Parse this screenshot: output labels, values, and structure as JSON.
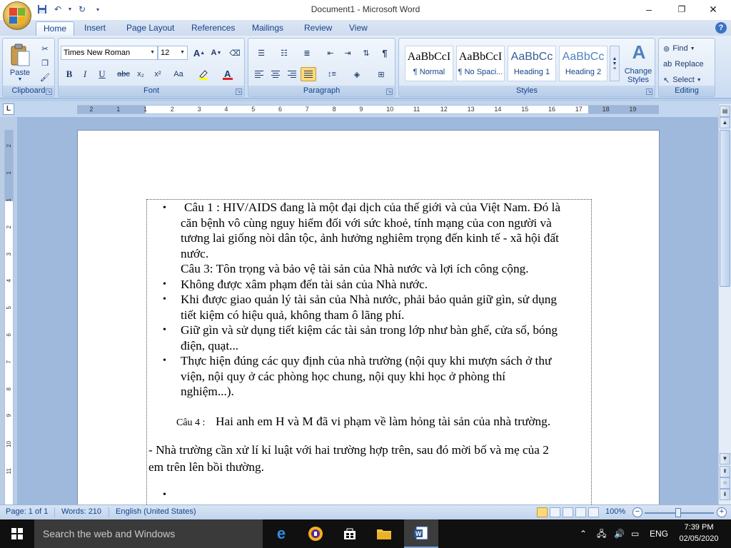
{
  "window": {
    "title": "Document1 - Microsoft Word",
    "minimize": "–",
    "maximize": "❐",
    "close": "✕"
  },
  "tabs": [
    "Home",
    "Insert",
    "Page Layout",
    "References",
    "Mailings",
    "Review",
    "View"
  ],
  "ribbon": {
    "clipboard": {
      "paste": "Paste",
      "label": "Clipboard"
    },
    "font": {
      "family": "Times New Roman",
      "size": "12",
      "label": "Font",
      "bold": "B",
      "italic": "I",
      "underline": "U",
      "strike": "abc",
      "subscript": "x₂",
      "superscript": "x²",
      "change_case": "Aa"
    },
    "paragraph": {
      "label": "Paragraph",
      "pilcrow": "¶"
    },
    "styles": {
      "label": "Styles",
      "items": [
        {
          "sample": "AaBbCcI",
          "name": "¶ Normal"
        },
        {
          "sample": "AaBbCcI",
          "name": "¶ No Spaci..."
        },
        {
          "sample": "AaBbCc",
          "name": "Heading 1"
        },
        {
          "sample": "AaBbCc",
          "name": "Heading 2"
        }
      ],
      "change_styles": "Change Styles"
    },
    "editing": {
      "label": "Editing",
      "find": "Find",
      "replace": "Replace",
      "select": "Select"
    }
  },
  "ruler": {
    "h_numbers": [
      "2",
      "1",
      "1",
      "2",
      "3",
      "4",
      "5",
      "6",
      "7",
      "8",
      "9",
      "10",
      "11",
      "12",
      "13",
      "14",
      "15",
      "16",
      "17",
      "18",
      "19"
    ],
    "v_numbers": [
      "2",
      "1",
      "1",
      "2",
      "3",
      "4",
      "5",
      "6",
      "7",
      "8",
      "9",
      "10",
      "11"
    ]
  },
  "document": {
    "lines": [
      "Câu 1  : HIV/AIDS đang là một đại dịch của thế giới và của Việt Nam. Đó là",
      "căn bệnh vô cùng nguy hiểm đối với sức khoẻ, tính mạng của con người và",
      "tương lai giống nòi dân tộc, ảnh hưởng nghiêm trọng đến kinh tế - xã hội đất",
      "nước.",
      "Câu 3: Tôn trọng và bảo vệ tài sản của Nhà nước và lợi ích công cộng.",
      "Không được xâm phạm đến tài sản của Nhà nước.",
      "Khi được giao quản lý tài sản của Nhà nước, phải bảo quản giữ gìn, sử dụng",
      "tiết kiệm có hiệu quả, không tham ô lãng phí.",
      "Giữ gìn và sử dụng tiết kiệm các tài sản trong lớp như bàn ghế, cửa sổ, bóng",
      "điện, quạt...",
      "Thực hiện đúng các quy định của nhà trường (nội quy khi mượn sách ở thư",
      "viện, nội quy ở các phòng học chung, nội quy khi học ở phòng thí",
      "nghiệm...).",
      "Câu 4 :",
      "Hai anh em H và M đã vi phạm về làm hỏng tài sản của nhà trường.",
      "- Nhà trường cần xử lí kỉ luật với hai trường hợp trên, sau đó mời bố và mẹ của 2",
      "em trên lên bồi thường."
    ],
    "bullet": "•"
  },
  "status": {
    "page": "Page: 1 of 1",
    "words": "Words: 210",
    "language": "English (United States)",
    "zoom": "100%"
  },
  "taskbar": {
    "search_placeholder": "Search the web and Windows",
    "lang": "ENG",
    "time": "7:39 PM",
    "date": "02/05/2020"
  }
}
